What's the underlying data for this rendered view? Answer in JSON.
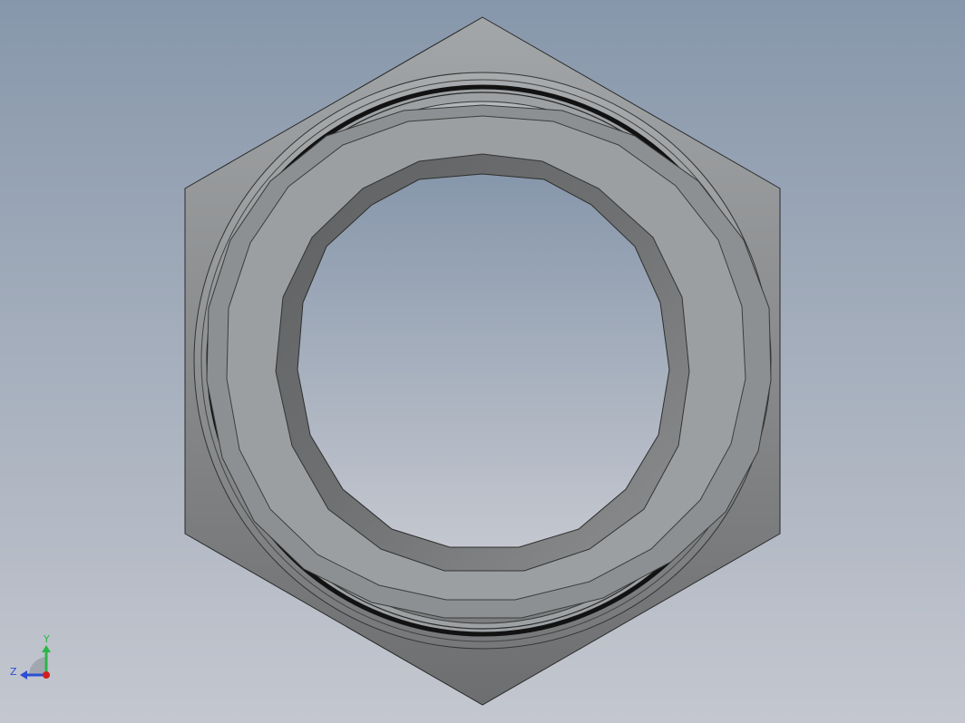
{
  "window": {
    "title": ""
  },
  "colors": {
    "background_top": "#8797ab",
    "background_bottom": "#c4c7cf",
    "part_face_light": "#9fa3a6",
    "part_face_mid": "#8a8c8e",
    "part_face_dark": "#6b6d6f",
    "edge": "#1e1e1e",
    "axis_x": "#d21e1e",
    "axis_y": "#2db54a",
    "axis_z": "#2c4fd4"
  },
  "triad": {
    "y_label": "Y",
    "z_label": "Z",
    "x_label": ""
  },
  "model": {
    "part_type": "hex-nut",
    "view": "front"
  }
}
